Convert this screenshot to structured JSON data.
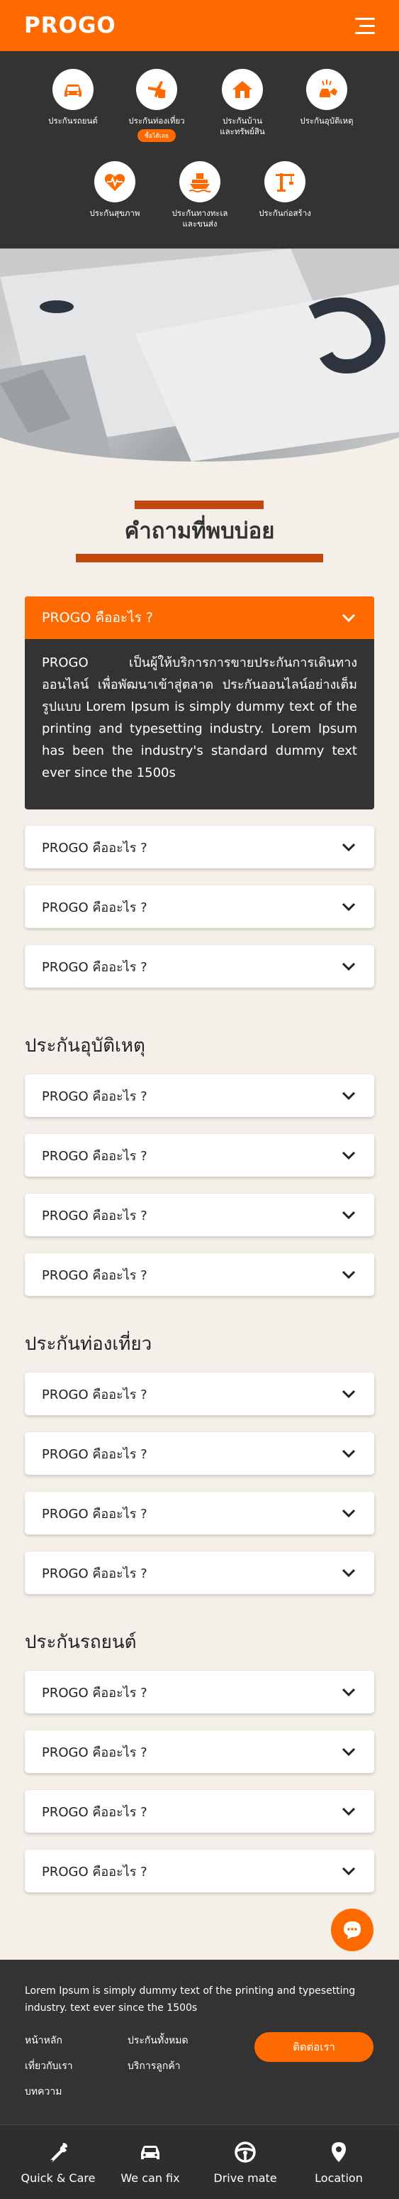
{
  "header": {
    "logo": "PROGO"
  },
  "categories": [
    {
      "label": "ประกันรถยนต์",
      "icon": "car-icon"
    },
    {
      "label": "ประกันท่องเที่ยว",
      "icon": "travel-icon",
      "badge": "ซื้อได้เลย"
    },
    {
      "label": "ประกันบ้าน\nและทรัพย์สิน",
      "icon": "house-icon"
    },
    {
      "label": "ประกันอุบัติเหตุ",
      "icon": "accident-icon"
    },
    {
      "label": "ประกันสุขภาพ",
      "icon": "health-icon"
    },
    {
      "label": "ประกันทางทะเล\nและขนส่ง",
      "icon": "ship-icon"
    },
    {
      "label": "ประกันก่อสร้าง",
      "icon": "construction-icon"
    }
  ],
  "faq": {
    "title": "คำถามที่พบบ่อย",
    "open_question": "PROGO คืออะไร ?",
    "open_answer": "PROGO เป็นผู้ให้บริการการขายประกันการเดินทางออนไลน์ เพื่อพัฒนาเข้าสู่ตลาด ประกันออนไลน์อย่างเต็มรูปแบบ Lorem Ipsum is simply dummy text of the printing and typesetting industry. Lorem Ipsum has been the industry's standard dummy text ever since the 1500s",
    "general": [
      "PROGO คืออะไร ?",
      "PROGO คืออะไร ?",
      "PROGO คืออะไร ?"
    ]
  },
  "sections": [
    {
      "title": "ประกันอุบัติเหตุ",
      "items": [
        "PROGO คืออะไร ?",
        "PROGO คืออะไร ?",
        "PROGO คืออะไร ?",
        "PROGO คืออะไร ?"
      ]
    },
    {
      "title": "ประกันท่องเที่ยว",
      "items": [
        "PROGO คืออะไร ?",
        "PROGO คืออะไร ?",
        "PROGO คืออะไร ?",
        "PROGO คืออะไร ?"
      ]
    },
    {
      "title": "ประกันรถยนต์",
      "items": [
        "PROGO คืออะไร ?",
        "PROGO คืออะไร ?",
        "PROGO คืออะไร ?",
        "PROGO คืออะไร ?"
      ]
    }
  ],
  "footer": {
    "description": "Lorem Ipsum is simply dummy text of the printing and typesetting industry. text ever since the 1500s",
    "links": [
      "หน้าหลัก",
      "ประกันทั้งหมด",
      "เที่ยวกับเรา",
      "บริการลูกค้า",
      "บทความ"
    ],
    "contact_label": "ติดต่อเรา"
  },
  "bottom_nav": [
    {
      "label": "Quick & Care",
      "icon": "wrench-icon"
    },
    {
      "label": "We can fix",
      "icon": "car-front-icon"
    },
    {
      "label": "Drive mate",
      "icon": "steering-wheel-icon"
    },
    {
      "label": "Location",
      "icon": "location-pin-icon"
    }
  ],
  "colors": {
    "brand": "#ff6a00",
    "dark": "#333333",
    "accent_bar": "#c0480f",
    "page_bg": "#f4efe8"
  }
}
